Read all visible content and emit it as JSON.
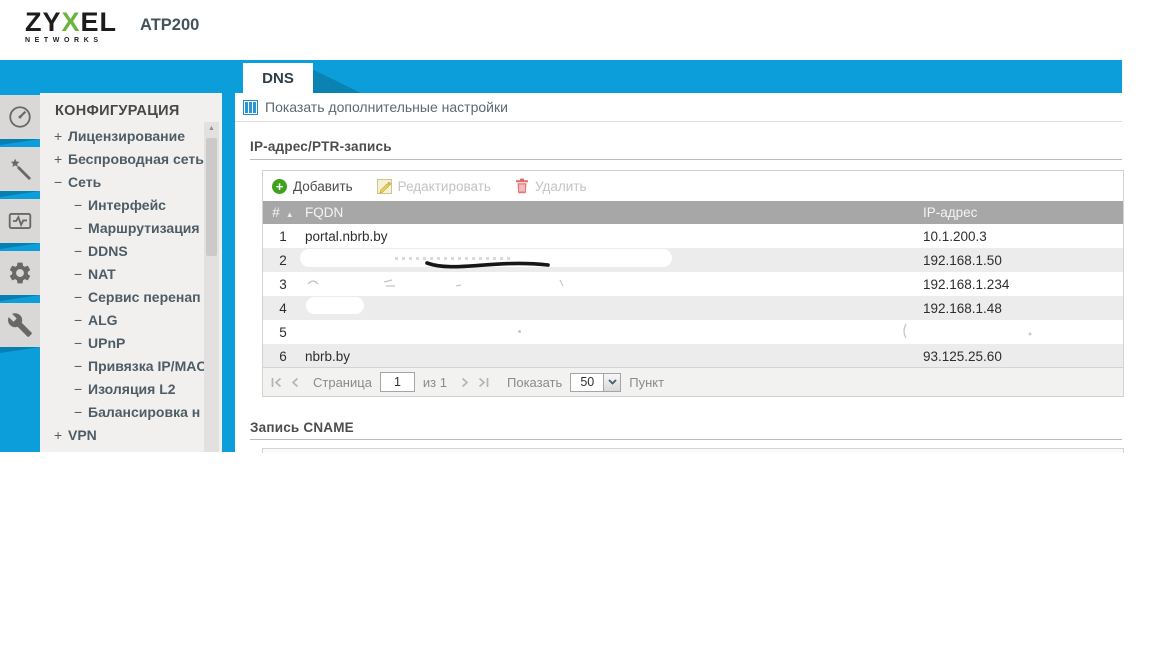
{
  "header": {
    "brand_top": "ZYXEL",
    "brand_bottom": "NETWORKS",
    "model": "ATP200"
  },
  "nav_tab": {
    "label": "DNS"
  },
  "iconbar": {
    "icons": [
      "dashboard-gauge-icon",
      "setup-wizard-icon",
      "monitoring-icon",
      "configuration-gear-icon",
      "maintenance-tools-icon"
    ]
  },
  "sidebar": {
    "title": "КОНФИГУРАЦИЯ",
    "items": [
      {
        "prefix": "+",
        "level": 1,
        "label": "Лицензирование"
      },
      {
        "prefix": "+",
        "level": 1,
        "label": "Беспроводная сеть"
      },
      {
        "prefix": "−",
        "level": 1,
        "label": "Сеть"
      },
      {
        "prefix": "−",
        "level": 2,
        "label": "Интерфейс"
      },
      {
        "prefix": "−",
        "level": 2,
        "label": "Маршрутизация"
      },
      {
        "prefix": "−",
        "level": 2,
        "label": "DDNS"
      },
      {
        "prefix": "−",
        "level": 2,
        "label": "NAT"
      },
      {
        "prefix": "−",
        "level": 2,
        "label": "Сервис перенап"
      },
      {
        "prefix": "−",
        "level": 2,
        "label": "ALG"
      },
      {
        "prefix": "−",
        "level": 2,
        "label": "UPnP"
      },
      {
        "prefix": "−",
        "level": 2,
        "label": "Привязка IP/MAC"
      },
      {
        "prefix": "−",
        "level": 2,
        "label": "Изоляция L2"
      },
      {
        "prefix": "−",
        "level": 2,
        "label": "Балансировка н"
      },
      {
        "prefix": "+",
        "level": 1,
        "label": "VPN"
      }
    ]
  },
  "content": {
    "advanced_toggle": "Показать дополнительные настройки",
    "ptr_section": {
      "title": "IP-адрес/PTR-запись",
      "toolbar": {
        "add": "Добавить",
        "edit": "Редактировать",
        "delete": "Удалить"
      },
      "table": {
        "col_num": "#",
        "col_fqdn": "FQDN",
        "col_ip": "IP-адрес",
        "sort": "asc",
        "rows": [
          {
            "num": "1",
            "fqdn": "portal.nbrb.by",
            "ip": "10.1.200.3"
          },
          {
            "num": "2",
            "fqdn": "",
            "ip": "192.168.1.50"
          },
          {
            "num": "3",
            "fqdn": "",
            "ip": "192.168.1.234"
          },
          {
            "num": "4",
            "fqdn": "",
            "ip": "192.168.1.48"
          },
          {
            "num": "5",
            "fqdn": "",
            "ip": ""
          },
          {
            "num": "6",
            "fqdn": "nbrb.by",
            "ip": "93.125.25.60"
          }
        ]
      },
      "pagination": {
        "page_label": "Страница",
        "page_value": "1",
        "of_label": "из 1",
        "show_label": "Показать",
        "page_size": "50",
        "unit_label": "Пункт"
      }
    },
    "cname_section": {
      "title": "Запись CNAME"
    }
  },
  "colors": {
    "accent_blue": "#0c9edb",
    "fold_blue": "#0a82b2",
    "brand_green": "#6cb33f",
    "table_header_gray": "#a7a7a7",
    "row_alt_gray": "#ececec",
    "add_green": "#3fa21c",
    "delete_red": "#e36d6d"
  }
}
